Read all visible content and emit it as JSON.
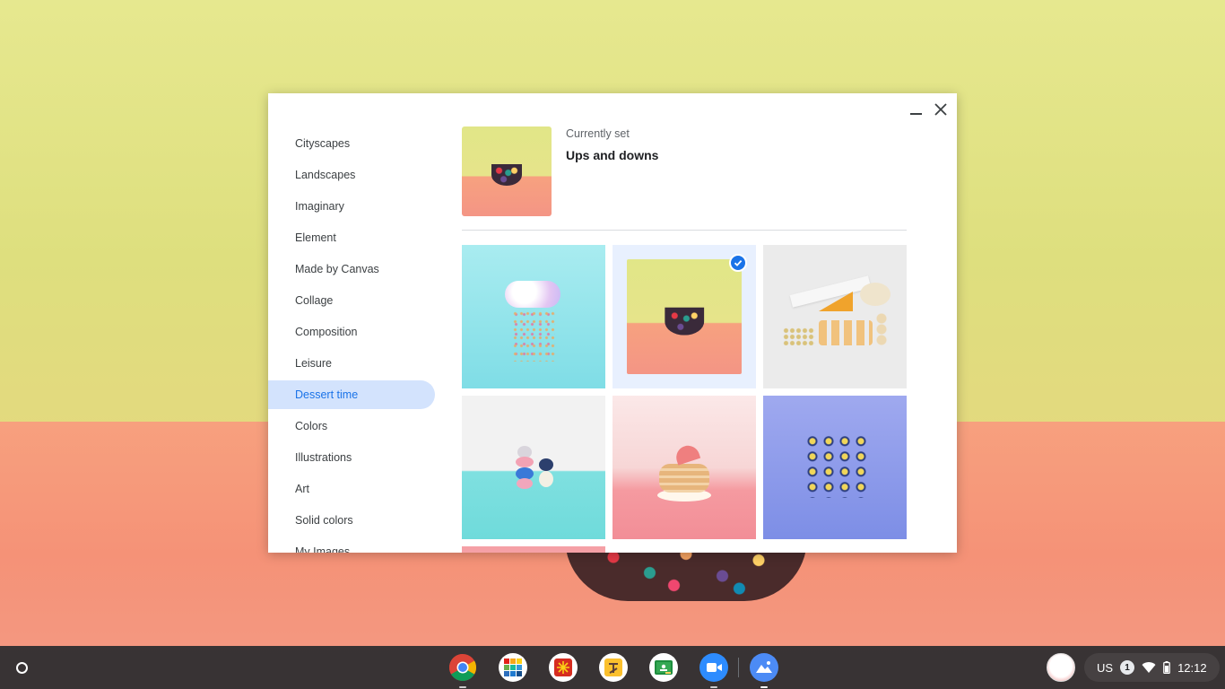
{
  "window": {
    "sidebar_items": [
      {
        "label": "Cityscapes",
        "active": false
      },
      {
        "label": "Landscapes",
        "active": false
      },
      {
        "label": "Imaginary",
        "active": false
      },
      {
        "label": "Element",
        "active": false
      },
      {
        "label": "Made by Canvas",
        "active": false
      },
      {
        "label": "Collage",
        "active": false
      },
      {
        "label": "Composition",
        "active": false
      },
      {
        "label": "Leisure",
        "active": false
      },
      {
        "label": "Dessert time",
        "active": true
      },
      {
        "label": "Colors",
        "active": false
      },
      {
        "label": "Illustrations",
        "active": false
      },
      {
        "label": "Art",
        "active": false
      },
      {
        "label": "Solid colors",
        "active": false
      },
      {
        "label": "My Images",
        "active": false
      }
    ],
    "current": {
      "label": "Currently set",
      "name": "Ups and downs"
    },
    "controls": {
      "minimize_icon": "minimize-icon",
      "close_icon": "close-icon"
    }
  },
  "shelf": {
    "apps": [
      "Chrome",
      "Tinkercad",
      "App 3",
      "App 4",
      "Google Classroom",
      "Zoom",
      "Wallpaper"
    ],
    "tray": {
      "input_method": "US",
      "notification_count": "1",
      "time": "12:12"
    }
  },
  "colors": {
    "accent": "#1a73e8",
    "active_nav_bg": "#d3e3fd",
    "shelf": "#2b2d31"
  }
}
